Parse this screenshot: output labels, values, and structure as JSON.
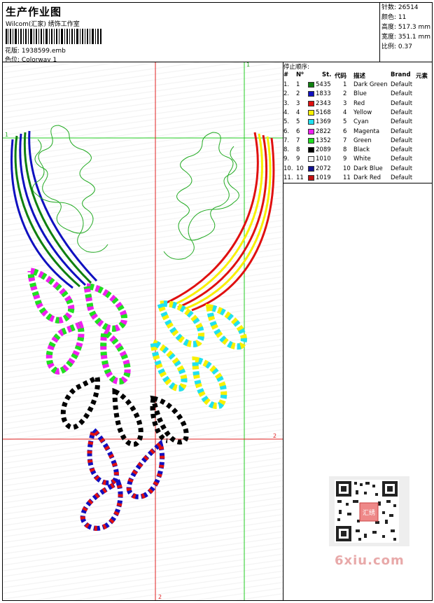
{
  "header": {
    "title": "生产作业图",
    "company": "Wilcom(汇家) 绣饰工作室",
    "design_label": "花版:",
    "design_value": "1938599.emb",
    "colorway_label": "色位:",
    "colorway_value": "Colorway 1"
  },
  "stats": {
    "stitches": "针数: 26514",
    "colors": "颜色: 11",
    "height": "高度: 517.3 mm",
    "width": "宽度: 351.1 mm",
    "ratio": "比例: 0.37"
  },
  "panel": {
    "stop_title": "停止顺序:",
    "headers": {
      "num": "#",
      "n": "N⁰",
      "st": "St.",
      "code": "代码",
      "desc": "描述",
      "brand": "Brand",
      "elem": "元素"
    },
    "rows": [
      {
        "num": "1.",
        "n": "1",
        "st": "5435",
        "code": "1",
        "desc": "Dark Green",
        "brand": "Default",
        "color": "#108010"
      },
      {
        "num": "2.",
        "n": "2",
        "st": "1833",
        "code": "2",
        "desc": "Blue",
        "brand": "Default",
        "color": "#1010c0"
      },
      {
        "num": "3.",
        "n": "3",
        "st": "2343",
        "code": "3",
        "desc": "Red",
        "brand": "Default",
        "color": "#e01010"
      },
      {
        "num": "4.",
        "n": "4",
        "st": "5168",
        "code": "4",
        "desc": "Yellow",
        "brand": "Default",
        "color": "#f8f000"
      },
      {
        "num": "5.",
        "n": "5",
        "st": "1369",
        "code": "5",
        "desc": "Cyan",
        "brand": "Default",
        "color": "#20e0f0"
      },
      {
        "num": "6.",
        "n": "6",
        "st": "2822",
        "code": "6",
        "desc": "Magenta",
        "brand": "Default",
        "color": "#f020f0"
      },
      {
        "num": "7.",
        "n": "7",
        "st": "1352",
        "code": "7",
        "desc": "Green",
        "brand": "Default",
        "color": "#20e020"
      },
      {
        "num": "8.",
        "n": "8",
        "st": "2089",
        "code": "8",
        "desc": "Black",
        "brand": "Default",
        "color": "#000000"
      },
      {
        "num": "9.",
        "n": "9",
        "st": "1010",
        "code": "9",
        "desc": "White",
        "brand": "Default",
        "color": "#f4f4f4"
      },
      {
        "num": "10.",
        "n": "10",
        "st": "2072",
        "code": "10",
        "desc": "Dark Blue",
        "brand": "Default",
        "color": "#101090"
      },
      {
        "num": "11.",
        "n": "11",
        "st": "1019",
        "code": "11",
        "desc": "Dark Red",
        "brand": "Default",
        "color": "#c01010"
      }
    ]
  },
  "canvas": {
    "marker_1": "1",
    "marker_2": "2"
  },
  "watermark": {
    "qr_text": "汇绣",
    "site": "6xiu.com"
  }
}
